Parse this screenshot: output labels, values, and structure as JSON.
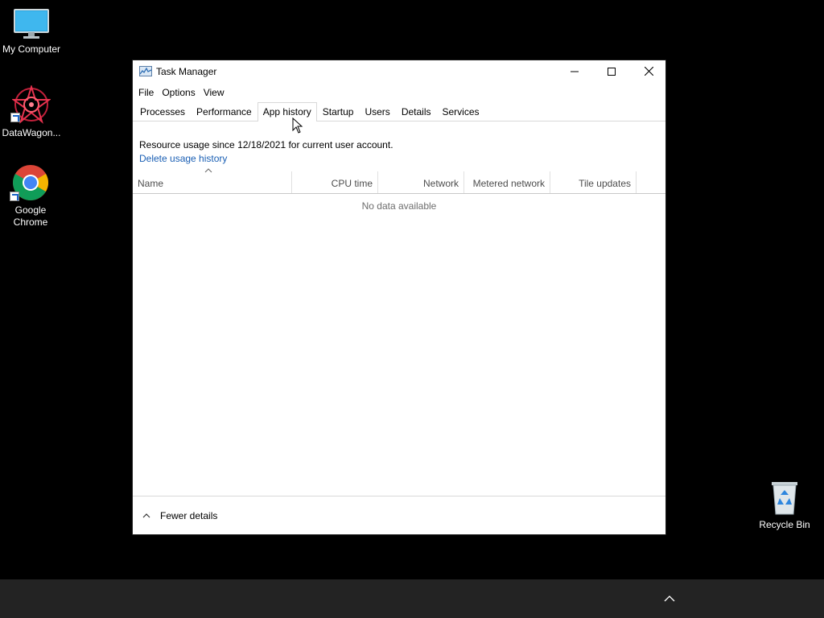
{
  "desktop": {
    "icons": [
      {
        "label": "My Computer",
        "icon": "monitor-icon"
      },
      {
        "label": "DataWagon...",
        "icon": "datawagon-logo-icon"
      },
      {
        "label": "Google Chrome",
        "label_line1": "Google",
        "label_line2": "Chrome",
        "icon": "chrome-icon"
      },
      {
        "label": "Recycle Bin",
        "icon": "recycle-bin-icon"
      }
    ]
  },
  "window": {
    "title": "Task Manager",
    "menu": [
      "File",
      "Options",
      "View"
    ],
    "tabs": [
      "Processes",
      "Performance",
      "App history",
      "Startup",
      "Users",
      "Details",
      "Services"
    ],
    "active_tab": "App history",
    "resource_text": "Resource usage since 12/18/2021 for current user account.",
    "delete_link": "Delete usage history",
    "columns": [
      "Name",
      "CPU time",
      "Network",
      "Metered network",
      "Tile updates"
    ],
    "empty_text": "No data available",
    "footer_text": "Fewer details"
  },
  "colors": {
    "link": "#1a5fb4",
    "desktop_bg": "#000000",
    "taskbar_bg": "#232323"
  }
}
